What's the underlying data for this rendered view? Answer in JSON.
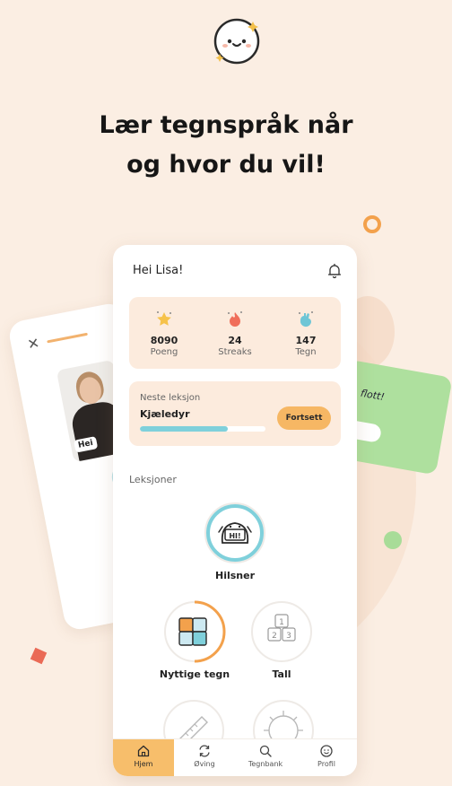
{
  "headline": {
    "line1": "Lær tegnspråk når",
    "line2": "og hvor du vil!"
  },
  "back_cards": {
    "left_sign_label": "Hei",
    "right_text": "flott!"
  },
  "app": {
    "greeting": "Hei Lisa!",
    "stats": [
      {
        "icon": "star-icon",
        "value": "8090",
        "label": "Poeng"
      },
      {
        "icon": "flame-icon",
        "value": "24",
        "label": "Streaks"
      },
      {
        "icon": "hand-sign-icon",
        "value": "147",
        "label": "Tegn"
      }
    ],
    "next_lesson": {
      "label": "Neste leksjon",
      "title": "Kjæledyr",
      "progress": 0.7,
      "button": "Fortsett"
    },
    "lessons_header": "Leksjoner",
    "lessons": [
      {
        "name": "Hilsner",
        "icon_text": "HI!",
        "progress": 1.0
      },
      {
        "name": "Nyttige tegn",
        "icon": "puzzle-icon",
        "progress": 0.5
      },
      {
        "name": "Tall",
        "icon_text": "1 2 3",
        "progress": 0
      }
    ],
    "nav": [
      {
        "label": "Hjem",
        "icon": "home-icon",
        "active": true
      },
      {
        "label": "Øving",
        "icon": "refresh-icon",
        "active": false
      },
      {
        "label": "Tegnbank",
        "icon": "search-icon",
        "active": false
      },
      {
        "label": "Profil",
        "icon": "smiley-icon",
        "active": false
      }
    ]
  },
  "colors": {
    "background": "#fbeee3",
    "accent_orange": "#f6b764",
    "teal": "#7fd0db",
    "green": "#aee09e",
    "red_square": "#ea6a56"
  }
}
